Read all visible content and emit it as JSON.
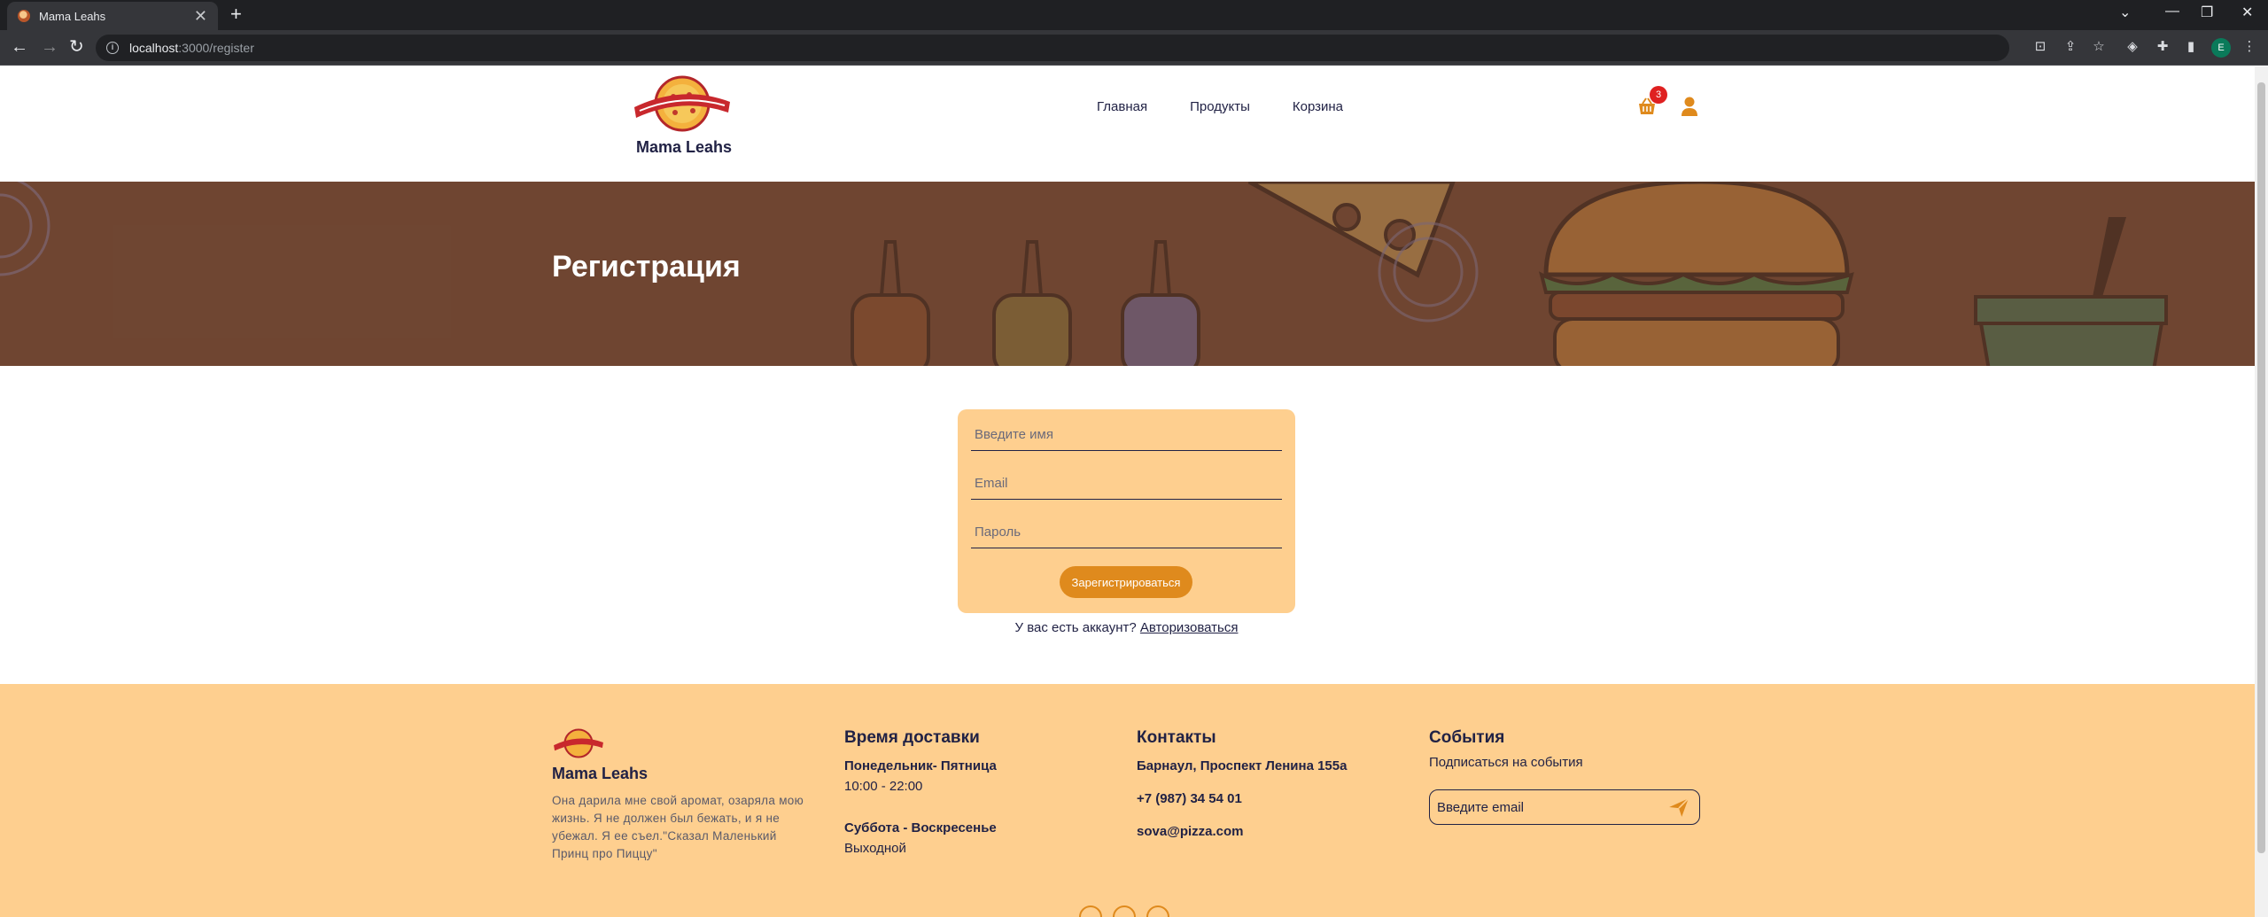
{
  "browser": {
    "tab_title": "Mama Leahs",
    "tab_close": "✕",
    "new_tab": "+",
    "url_host": "localhost",
    "url_path": ":3000/register",
    "profile_initial": "E",
    "window_controls": [
      "⌄",
      "—",
      "❐",
      "✕"
    ]
  },
  "header": {
    "logo_text": "Mama Leahs",
    "nav": [
      "Главная",
      "Продукты",
      "Корзина"
    ],
    "cart_count": "3"
  },
  "hero": {
    "title": "Регистрация"
  },
  "form": {
    "name_placeholder": "Введите имя",
    "email_placeholder": "Email",
    "password_placeholder": "Пароль",
    "submit_label": "Зарегистрироваться",
    "login_prompt": "У вас есть аккаунт?",
    "login_link": "Авторизоваться"
  },
  "footer": {
    "brand": "Mama Leahs",
    "description": "Она дарила мне свой аромат, озаряла мою жизнь. Я не должен был бежать, и я не убежал. Я ее съел.\"Сказал Маленький Принц про Пиццу\"",
    "delivery": {
      "title": "Время доставки",
      "weekdays_label": "Понедельник- Пятница",
      "weekdays_hours": "10:00 - 22:00",
      "weekend_label": "Суббота - Воскресенье",
      "weekend_hours": "Выходной"
    },
    "contacts": {
      "title": "Контакты",
      "address": "Барнаул, Проспект Ленина 155а",
      "phone": "+7 (987) 34 54 01",
      "email": "sova@pizza.com"
    },
    "events": {
      "title": "События",
      "subtitle": "Подписаться на события",
      "email_placeholder": "Введите email"
    }
  },
  "colors": {
    "primary_dark": "#212245",
    "accent_orange": "#df8a1d",
    "peach": "#fecf8f",
    "hero_brown": "#6f4632",
    "badge_red": "#df2020"
  }
}
